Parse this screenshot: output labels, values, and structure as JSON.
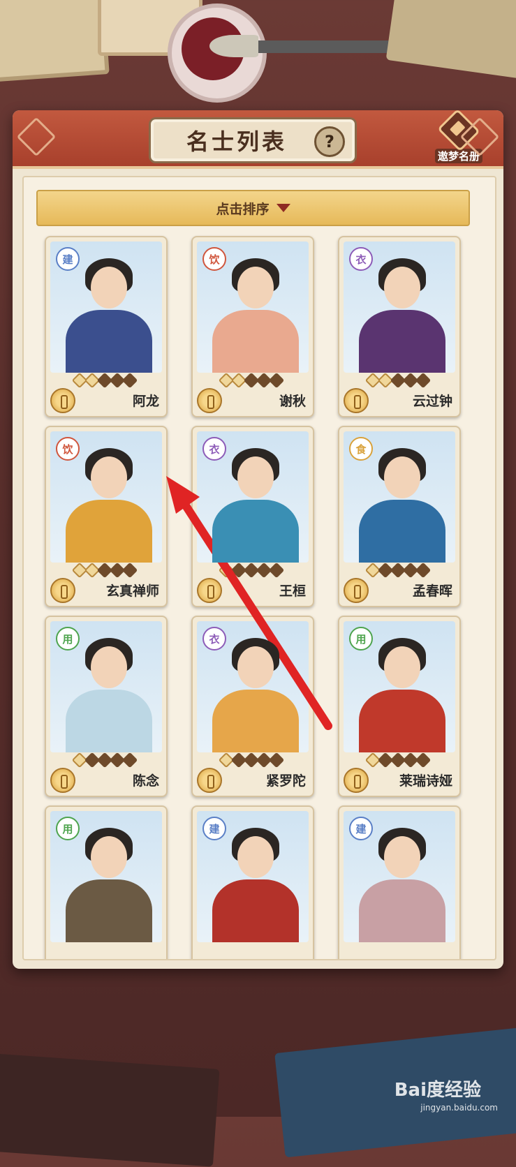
{
  "header": {
    "title": "名士列表",
    "help_label": "?",
    "dream_book_label": "遨梦名册"
  },
  "sort": {
    "label": "点击排序"
  },
  "cards": [
    {
      "name": "阿龙",
      "tag": "建",
      "tag_color": "#5a7fc6",
      "lit_stars": 2,
      "total_stars": 5,
      "outfit_color": "#3b4f8e"
    },
    {
      "name": "谢秋",
      "tag": "饮",
      "tag_color": "#d0563d",
      "lit_stars": 2,
      "total_stars": 5,
      "outfit_color": "#e9a98f"
    },
    {
      "name": "云过钟",
      "tag": "衣",
      "tag_color": "#8d5cb8",
      "lit_stars": 2,
      "total_stars": 5,
      "outfit_color": "#5a3470"
    },
    {
      "name": "玄真禅师",
      "tag": "饮",
      "tag_color": "#d0563d",
      "lit_stars": 2,
      "total_stars": 5,
      "outfit_color": "#e0a33a"
    },
    {
      "name": "王桓",
      "tag": "衣",
      "tag_color": "#8d5cb8",
      "lit_stars": 1,
      "total_stars": 5,
      "outfit_color": "#3a8fb4"
    },
    {
      "name": "孟春晖",
      "tag": "食",
      "tag_color": "#d9a23c",
      "lit_stars": 1,
      "total_stars": 5,
      "outfit_color": "#2f6ea3"
    },
    {
      "name": "陈念",
      "tag": "用",
      "tag_color": "#4ea44e",
      "lit_stars": 1,
      "total_stars": 5,
      "outfit_color": "#bcd7e4"
    },
    {
      "name": "紧罗陀",
      "tag": "衣",
      "tag_color": "#8d5cb8",
      "lit_stars": 1,
      "total_stars": 5,
      "outfit_color": "#e6a64a"
    },
    {
      "name": "莱瑞诗娅",
      "tag": "用",
      "tag_color": "#4ea44e",
      "lit_stars": 1,
      "total_stars": 5,
      "outfit_color": "#c0392b"
    },
    {
      "name": "",
      "tag": "用",
      "tag_color": "#4ea44e",
      "lit_stars": 0,
      "total_stars": 0,
      "outfit_color": "#6b5a44"
    },
    {
      "name": "",
      "tag": "建",
      "tag_color": "#5a7fc6",
      "lit_stars": 0,
      "total_stars": 0,
      "outfit_color": "#b3322a"
    },
    {
      "name": "",
      "tag": "建",
      "tag_color": "#5a7fc6",
      "lit_stars": 0,
      "total_stars": 0,
      "outfit_color": "#c8a0a4"
    }
  ],
  "watermark": {
    "text": "Bai度经验",
    "url": "jingyan.baidu.com"
  }
}
